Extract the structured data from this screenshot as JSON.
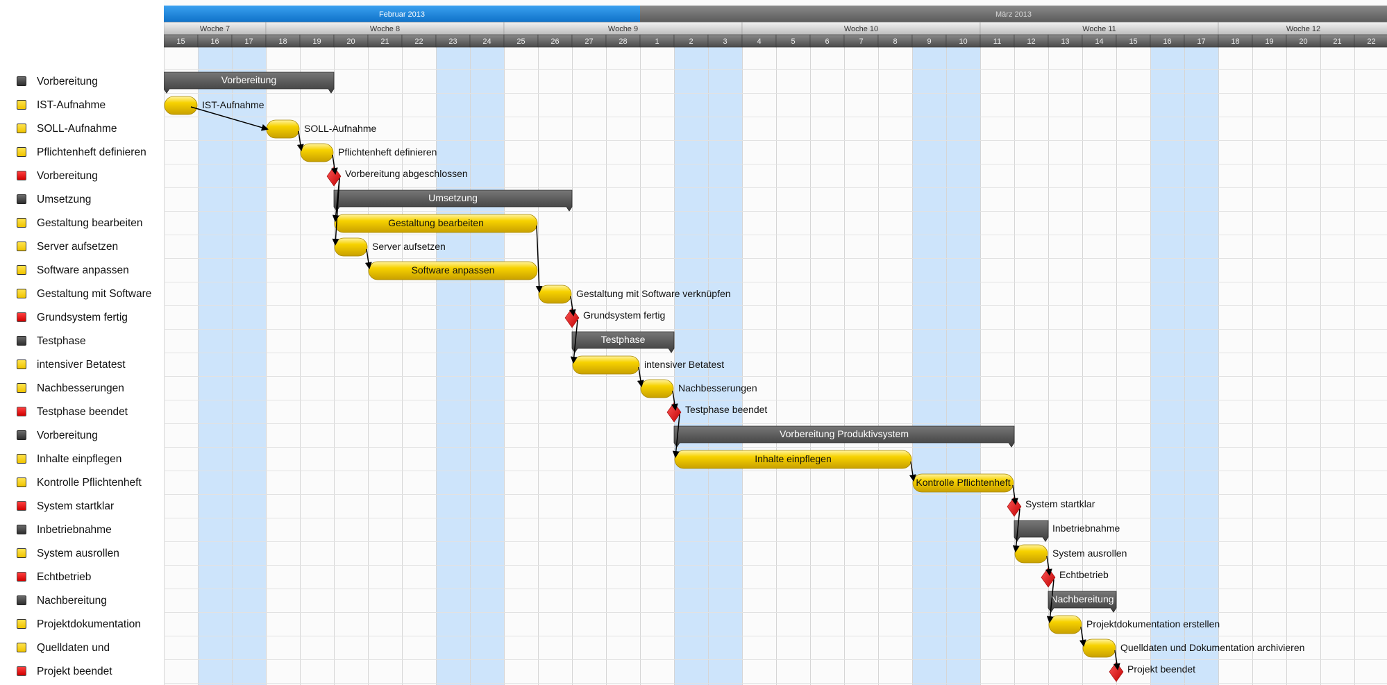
{
  "months": [
    {
      "label": "Februar 2013",
      "active": true
    },
    {
      "label": "März 2013",
      "active": false
    }
  ],
  "weeks": [
    "Woche 7",
    "Woche 8",
    "Woche 9",
    "Woche 10",
    "Woche 11",
    "Woche 12"
  ],
  "days": [
    "15",
    "16",
    "17",
    "18",
    "19",
    "20",
    "21",
    "22",
    "23",
    "24",
    "25",
    "26",
    "27",
    "28",
    "1",
    "2",
    "3",
    "4",
    "5",
    "6",
    "7",
    "8",
    "9",
    "10",
    "11",
    "12",
    "13",
    "14",
    "15",
    "16",
    "17",
    "18",
    "19",
    "20",
    "21",
    "22"
  ],
  "weekend_day_indexes": [
    1,
    2,
    8,
    9,
    15,
    16,
    22,
    23,
    29,
    30
  ],
  "colors": {
    "month_active": "#1a88e0",
    "month_inactive": "#6b6b6b",
    "weekend": "#cde4fb",
    "task_fill": "#f7d200",
    "summary_fill": "#3c3c3c",
    "milestone_fill": "#e81010"
  },
  "tasks": [
    {
      "name": "Vorbereitung",
      "type": "summary",
      "start": 0,
      "end": 5,
      "label": "Vorbereitung",
      "label_pos": "inside"
    },
    {
      "name": "IST-Aufnahme",
      "type": "task",
      "start": 0,
      "end": 1,
      "label": "IST-Aufnahme",
      "label_pos": "right"
    },
    {
      "name": "SOLL-Aufnahme",
      "type": "task",
      "start": 3,
      "end": 4,
      "label": "SOLL-Aufnahme",
      "label_pos": "right"
    },
    {
      "name": "Pflichtenheft definieren",
      "type": "task",
      "start": 4,
      "end": 5,
      "label": "Pflichtenheft definieren",
      "label_pos": "right"
    },
    {
      "name": "Vorbereitung",
      "type": "milestone",
      "start": 5,
      "end": 5,
      "label": "Vorbereitung abgeschlossen",
      "label_pos": "right"
    },
    {
      "name": "Umsetzung",
      "type": "summary",
      "start": 5,
      "end": 12,
      "label": "Umsetzung",
      "label_pos": "inside"
    },
    {
      "name": "Gestaltung bearbeiten",
      "type": "task",
      "start": 5,
      "end": 11,
      "label": "Gestaltung bearbeiten",
      "label_pos": "inside"
    },
    {
      "name": "Server aufsetzen",
      "type": "task",
      "start": 5,
      "end": 6,
      "label": "Server aufsetzen",
      "label_pos": "right"
    },
    {
      "name": "Software anpassen",
      "type": "task",
      "start": 6,
      "end": 11,
      "label": "Software anpassen",
      "label_pos": "inside"
    },
    {
      "name": "Gestaltung mit Software",
      "type": "task",
      "start": 11,
      "end": 12,
      "label": "Gestaltung mit Software verknüpfen",
      "label_pos": "right"
    },
    {
      "name": "Grundsystem fertig",
      "type": "milestone",
      "start": 12,
      "end": 12,
      "label": "Grundsystem fertig",
      "label_pos": "right"
    },
    {
      "name": "Testphase",
      "type": "summary",
      "start": 12,
      "end": 15,
      "label": "Testphase",
      "label_pos": "inside"
    },
    {
      "name": "intensiver Betatest",
      "type": "task",
      "start": 12,
      "end": 14,
      "label": "intensiver Betatest",
      "label_pos": "right"
    },
    {
      "name": "Nachbesserungen",
      "type": "task",
      "start": 14,
      "end": 15,
      "label": "Nachbesserungen",
      "label_pos": "right"
    },
    {
      "name": "Testphase beendet",
      "type": "milestone",
      "start": 15,
      "end": 15,
      "label": "Testphase beendet",
      "label_pos": "right"
    },
    {
      "name": "Vorbereitung",
      "type": "summary",
      "start": 15,
      "end": 25,
      "label": "Vorbereitung Produktivsystem",
      "label_pos": "inside"
    },
    {
      "name": "Inhalte einpflegen",
      "type": "task",
      "start": 15,
      "end": 22,
      "label": "Inhalte einpflegen",
      "label_pos": "inside"
    },
    {
      "name": "Kontrolle Pflichtenheft",
      "type": "task",
      "start": 22,
      "end": 25,
      "label": "Kontrolle Pflichtenheft",
      "label_pos": "inside"
    },
    {
      "name": "System startklar",
      "type": "milestone",
      "start": 25,
      "end": 25,
      "label": "System startklar",
      "label_pos": "right"
    },
    {
      "name": "Inbetriebnahme",
      "type": "summary",
      "start": 25,
      "end": 26,
      "label": "Inbetriebnahme",
      "label_pos": "right"
    },
    {
      "name": "System ausrollen",
      "type": "task",
      "start": 25,
      "end": 26,
      "label": "System ausrollen",
      "label_pos": "right"
    },
    {
      "name": "Echtbetrieb",
      "type": "milestone",
      "start": 26,
      "end": 26,
      "label": "Echtbetrieb",
      "label_pos": "right"
    },
    {
      "name": "Nachbereitung",
      "type": "summary",
      "start": 26,
      "end": 28,
      "label": "Nachbereitung",
      "label_pos": "inside"
    },
    {
      "name": "Projektdokumentation",
      "type": "task",
      "start": 26,
      "end": 27,
      "label": "Projektdokumentation erstellen",
      "label_pos": "right"
    },
    {
      "name": "Quelldaten und",
      "type": "task",
      "start": 27,
      "end": 28,
      "label": "Quelldaten und Dokumentation archivieren",
      "label_pos": "right"
    },
    {
      "name": "Projekt beendet",
      "type": "milestone",
      "start": 28,
      "end": 28,
      "label": "Projekt beendet",
      "label_pos": "right"
    }
  ]
}
